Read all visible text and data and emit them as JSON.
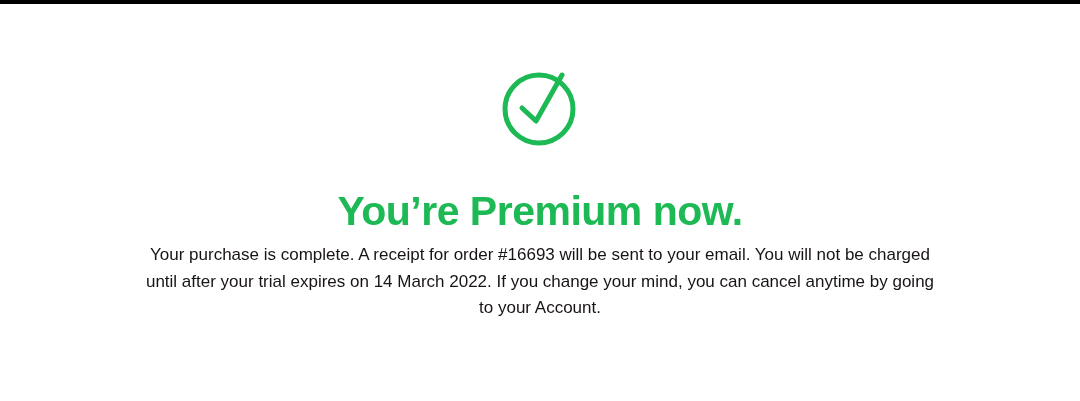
{
  "title": "You’re Premium now.",
  "message": "Your purchase is complete. A receipt for order #16693 will be sent to your email. You will not be charged until after your trial expires on 14 March 2022. If you change your mind, you can cancel anytime by going to your Account."
}
